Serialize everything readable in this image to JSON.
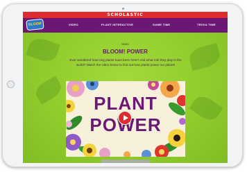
{
  "brand": "SCHOLASTIC",
  "logo": {
    "text": "BLOOM"
  },
  "nav": [
    {
      "label": "VIDEO"
    },
    {
      "label": "PLANT INTERACTIVE"
    },
    {
      "label": "GAME TIME"
    },
    {
      "label": "TRIVIA TIME"
    }
  ],
  "section_label": "VIDEO",
  "title": "BLOOM! POWER",
  "description": "Ever wondered how long plants have been here? And what role they play in the world? Watch the video below to find out how plants power our planet!",
  "video": {
    "title_line1": "PLANT",
    "title_line2": "POWER"
  },
  "colors": {
    "brand_red": "#e02c2e",
    "nav_purple": "#6a1874",
    "background_green": "#8fcb2c"
  }
}
